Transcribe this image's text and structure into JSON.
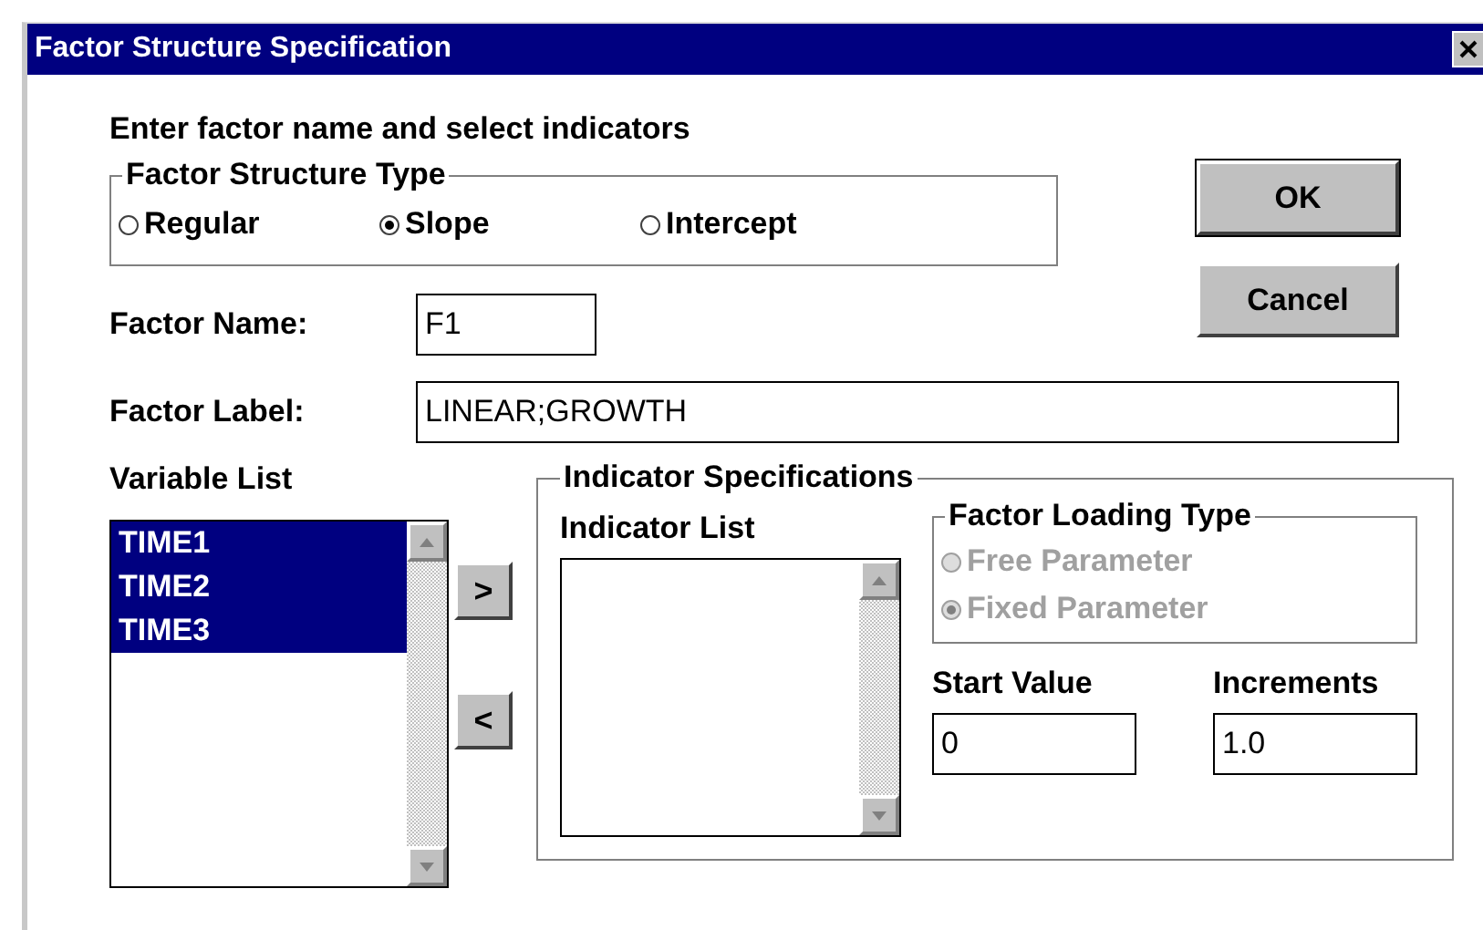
{
  "window": {
    "title": "Factor Structure Specification"
  },
  "instruction": "Enter factor name and select indicators",
  "factor_structure_type": {
    "title": "Factor Structure Type",
    "options": [
      {
        "label": "Regular",
        "selected": false
      },
      {
        "label": "Slope",
        "selected": true
      },
      {
        "label": "Intercept",
        "selected": false
      }
    ]
  },
  "buttons": [
    {
      "label": "OK",
      "kind": "default"
    },
    {
      "label": "Cancel",
      "kind": "normal"
    }
  ],
  "factor_name": {
    "label": "Factor Name:",
    "value": "F1"
  },
  "factor_label": {
    "label": "Factor Label:",
    "value": "LINEAR;GROWTH"
  },
  "variable_list": {
    "title": "Variable List",
    "items": [
      {
        "label": "TIME1",
        "selected": true
      },
      {
        "label": "TIME2",
        "selected": true
      },
      {
        "label": "TIME3",
        "selected": true
      }
    ]
  },
  "move_buttons": [
    ">",
    "<"
  ],
  "indicator_specifications": {
    "title": "Indicator Specifications",
    "indicator_list": {
      "title": "Indicator List"
    },
    "factor_loading_type": {
      "title": "Factor Loading Type",
      "disabled": true,
      "options": [
        {
          "label": "Free Parameter",
          "selected": false
        },
        {
          "label": "Fixed Parameter",
          "selected": true
        }
      ]
    },
    "start_value": {
      "label": "Start Value",
      "value": "0"
    },
    "increments": {
      "label": "Increments",
      "value": "1.0"
    }
  }
}
